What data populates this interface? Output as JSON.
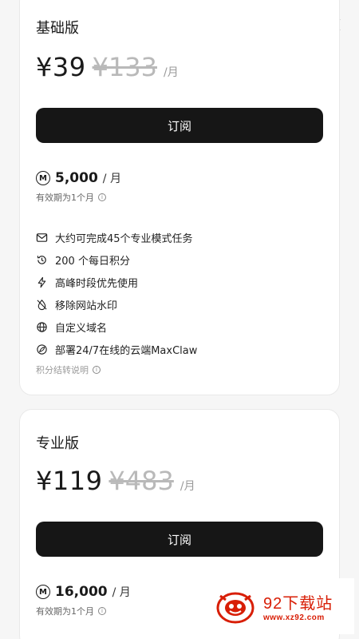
{
  "close": {
    "icon": "close-icon"
  },
  "plans": [
    {
      "name": "基础版",
      "price": "¥39",
      "original_price": "¥133",
      "per": "/月",
      "subscribe_label": "订阅",
      "credits_icon": "M",
      "credits_amount": "5,000",
      "credits_unit": "/ 月",
      "validity": "有效期为1个月",
      "features": [
        {
          "icon": "mail-icon",
          "text": "大约可完成45个专业模式任务"
        },
        {
          "icon": "history-icon",
          "text": "200 个每日积分"
        },
        {
          "icon": "lightning-icon",
          "text": "高峰时段优先使用"
        },
        {
          "icon": "no-watermark-icon",
          "text": "移除网站水印"
        },
        {
          "icon": "globe-icon",
          "text": "自定义域名"
        },
        {
          "icon": "cloud-deploy-icon",
          "text": "部署24/7在线的云端MaxClaw"
        }
      ],
      "note": "积分结转说明"
    },
    {
      "name": "专业版",
      "price": "¥119",
      "original_price": "¥483",
      "per": "/月",
      "subscribe_label": "订阅",
      "credits_icon": "M",
      "credits_amount": "16,000",
      "credits_unit": "/ 月",
      "validity": "有效期为1个月"
    }
  ],
  "watermark": {
    "title": "92下载站",
    "url": "www.xz92.com"
  },
  "colors": {
    "button": "#161616",
    "strike": "#b9b9b9",
    "watermark": "#d81e06"
  }
}
